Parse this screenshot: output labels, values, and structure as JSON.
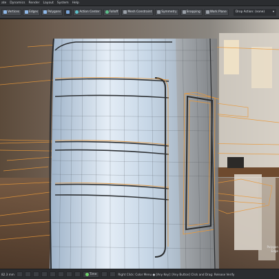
{
  "menubar": {
    "items": [
      {
        "label": "ate"
      },
      {
        "label": "Dynamics"
      },
      {
        "label": "Render"
      },
      {
        "label": "Layout"
      },
      {
        "label": "System"
      },
      {
        "label": "Help"
      }
    ]
  },
  "toolbar": {
    "vertices": "Vertices",
    "edges": "Edges",
    "polygons": "Polygons",
    "action_center": "Action Center",
    "falloff": "Falloff",
    "mesh_constraint": "Mesh Constraint",
    "symmetry": "Symmetry",
    "snapping": "Snapping",
    "work_plane": "Work Plane",
    "drop_action": "Drop Action: (none)"
  },
  "viewport": {
    "corner_label": "",
    "side_label_1": "Polygon",
    "side_label_2": "Edge"
  },
  "statusbar": {
    "coords": "82.3 mm",
    "time_label": "Time",
    "hint": "Right Click: Color Menu ● [Any Key]: [Any Button] Click and Drag: Release Verify"
  },
  "colors": {
    "wire_orange": "#e8983a",
    "wire_dark": "#3a3c3e",
    "mesh_light": "#cfe0f2",
    "background_mid": "#7f7c78"
  }
}
